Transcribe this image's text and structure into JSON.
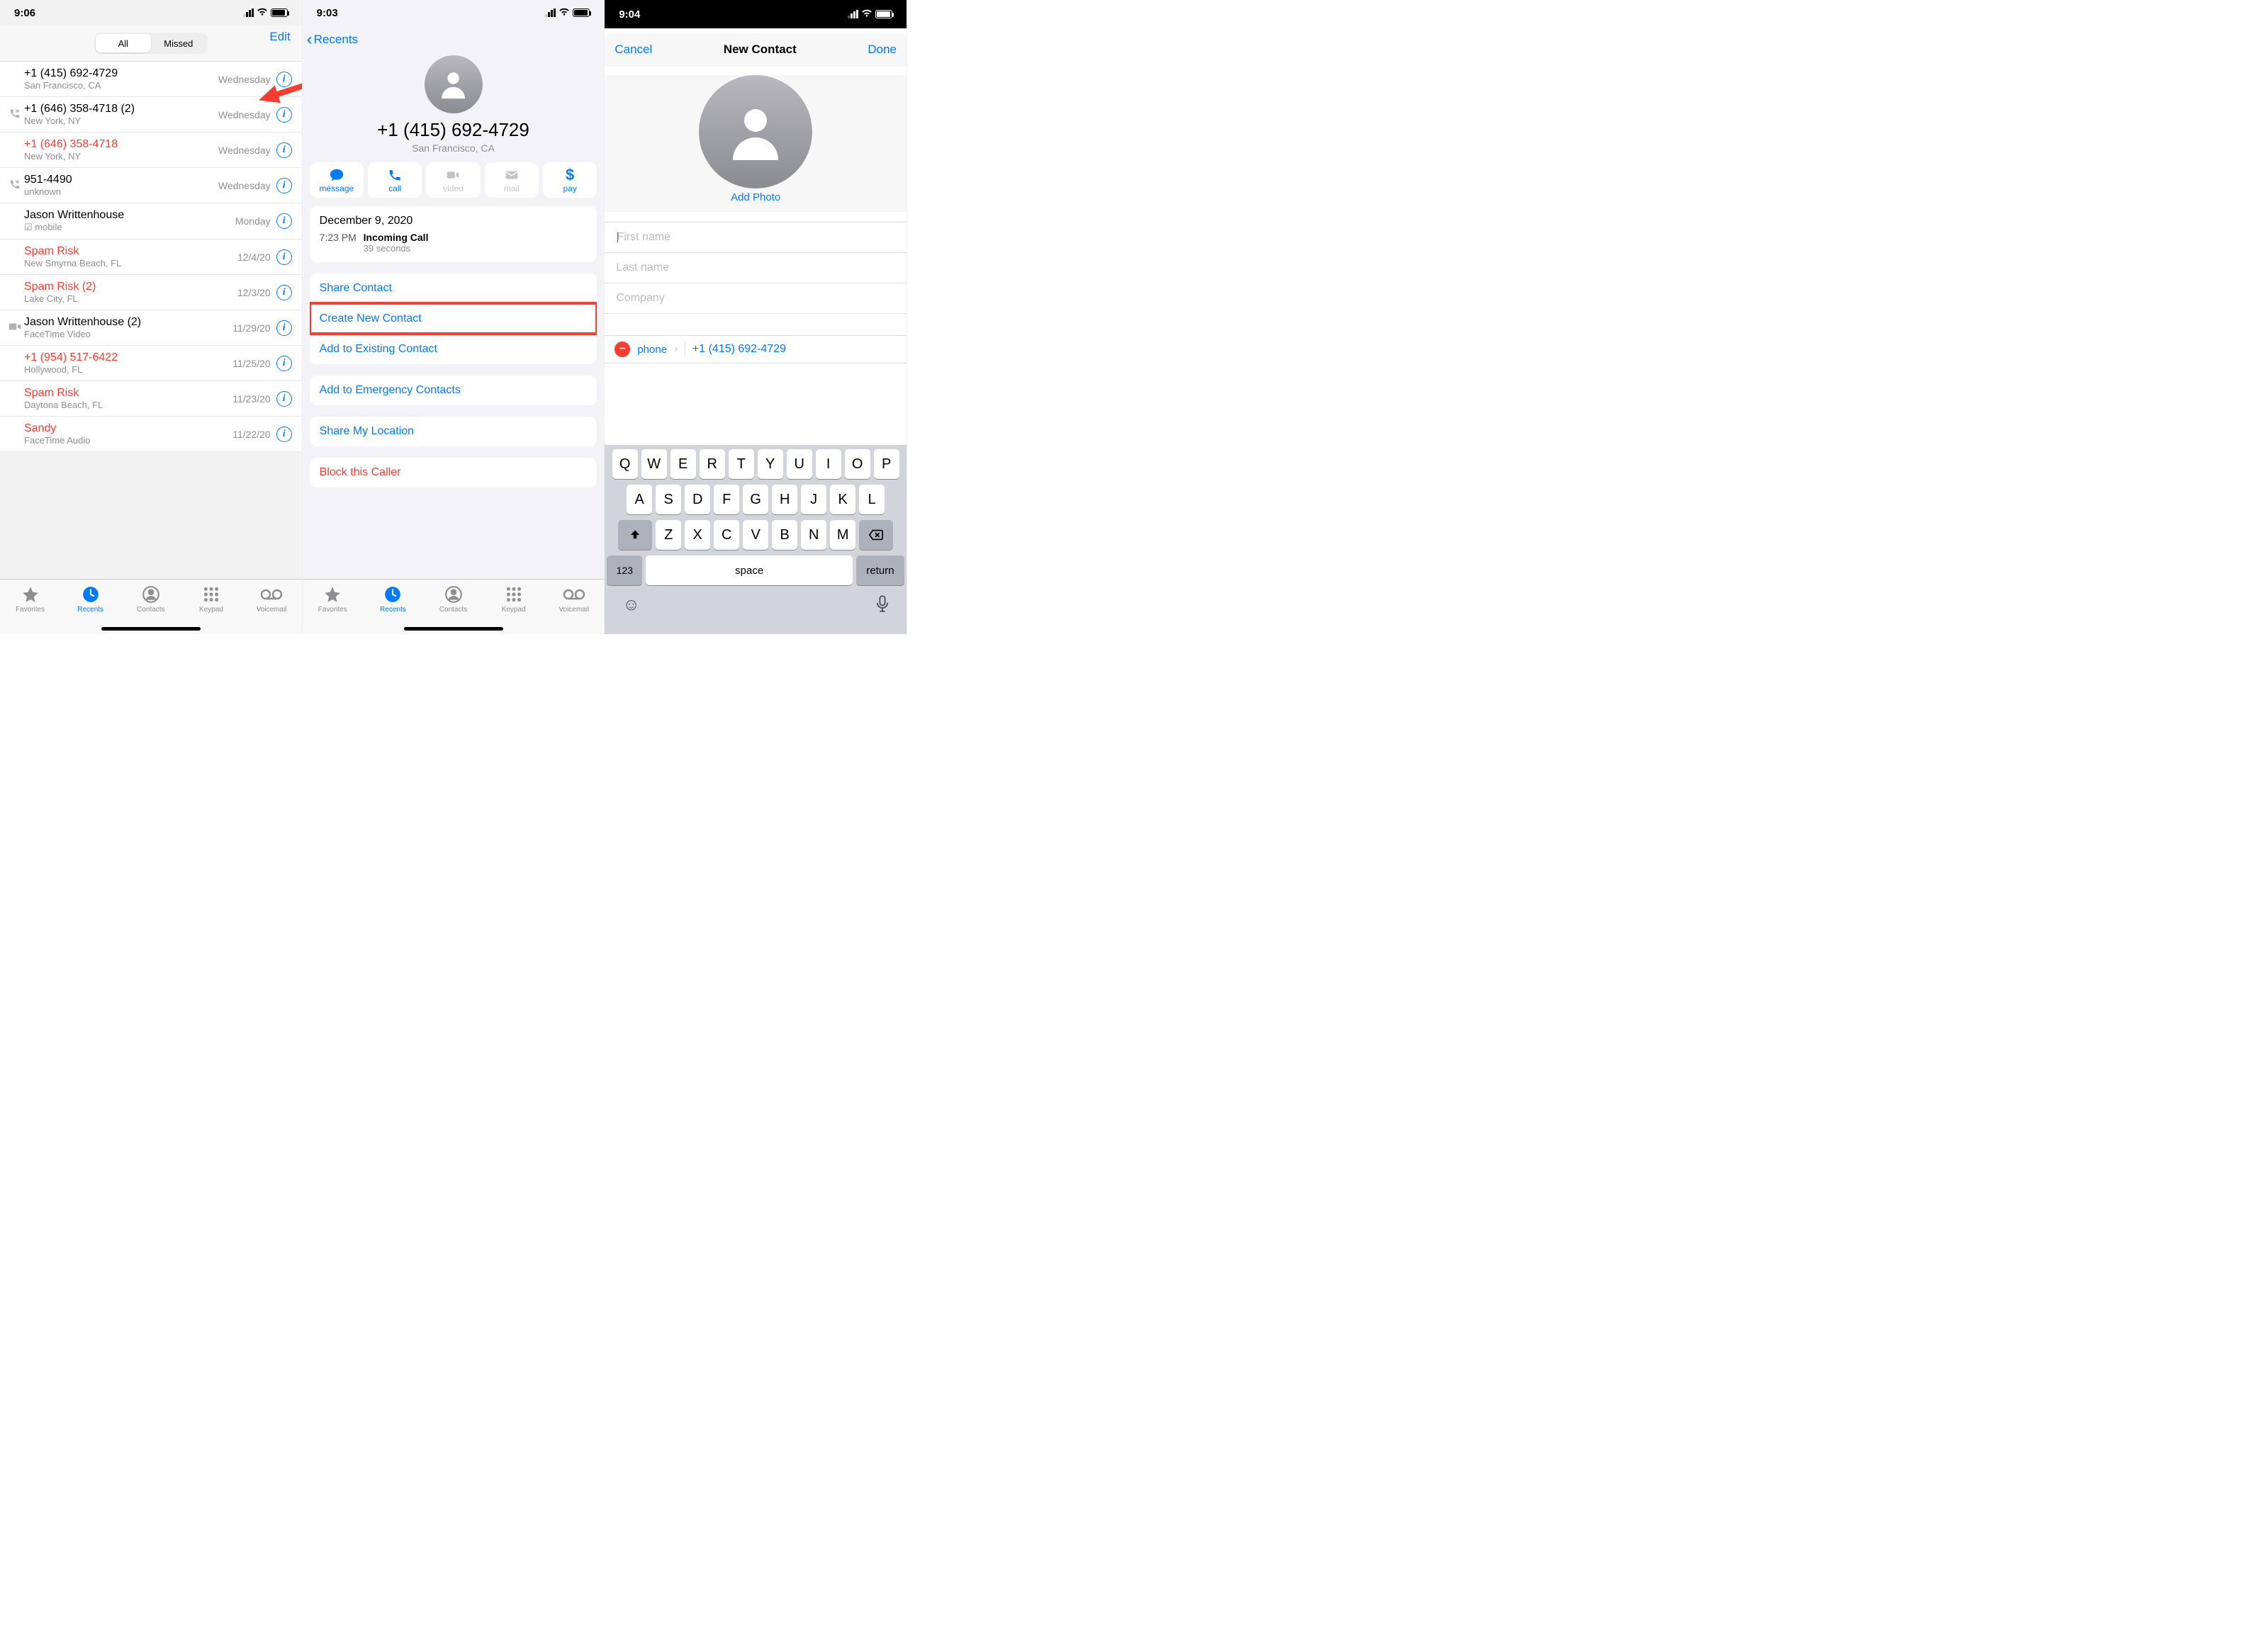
{
  "panel1": {
    "time": "9:06",
    "seg_all": "All",
    "seg_missed": "Missed",
    "edit": "Edit",
    "calls": [
      {
        "icon": "",
        "title": "+1 (415) 692-4729",
        "sub": "San Francisco, CA",
        "date": "Wednesday",
        "red": false
      },
      {
        "icon": "out",
        "title": "+1 (646) 358-4718 (2)",
        "sub": "New York, NY",
        "date": "Wednesday",
        "red": false
      },
      {
        "icon": "",
        "title": "+1 (646) 358-4718",
        "sub": "New York, NY",
        "date": "Wednesday",
        "red": true
      },
      {
        "icon": "out",
        "title": "951-4490",
        "sub": "unknown",
        "date": "Wednesday",
        "red": false
      },
      {
        "icon": "",
        "title": "Jason Writtenhouse",
        "sub": "☑ mobile",
        "date": "Monday",
        "red": false
      },
      {
        "icon": "",
        "title": "Spam Risk",
        "sub": "New Smyrna Beach, FL",
        "date": "12/4/20",
        "red": true
      },
      {
        "icon": "",
        "title": "Spam Risk (2)",
        "sub": "Lake City, FL",
        "date": "12/3/20",
        "red": true
      },
      {
        "icon": "video",
        "title": "Jason Writtenhouse (2)",
        "sub": "FaceTime Video",
        "date": "11/29/20",
        "red": false
      },
      {
        "icon": "",
        "title": "+1 (954) 517-6422",
        "sub": "Hollywood, FL",
        "date": "11/25/20",
        "red": true
      },
      {
        "icon": "",
        "title": "Spam Risk",
        "sub": "Daytona Beach, FL",
        "date": "11/23/20",
        "red": true
      },
      {
        "icon": "",
        "title": "Sandy",
        "sub": "FaceTime Audio",
        "date": "11/22/20",
        "red": true
      }
    ],
    "tabs": {
      "fav": "Favorites",
      "rec": "Recents",
      "con": "Contacts",
      "key": "Keypad",
      "vm": "Voicemail"
    }
  },
  "panel2": {
    "time": "9:03",
    "back": "Recents",
    "number": "+1 (415) 692-4729",
    "location": "San Francisco, CA",
    "actions": {
      "message": "message",
      "call": "call",
      "video": "video",
      "mail": "mail",
      "pay": "pay"
    },
    "history": {
      "date": "December 9, 2020",
      "time": "7:23 PM",
      "label": "Incoming Call",
      "dur": "39 seconds"
    },
    "menu": {
      "share": "Share Contact",
      "create": "Create New Contact",
      "add": "Add to Existing Contact",
      "emerg": "Add to Emergency Contacts",
      "loc": "Share My Location",
      "block": "Block this Caller"
    },
    "tabs": {
      "fav": "Favorites",
      "rec": "Recents",
      "con": "Contacts",
      "key": "Keypad",
      "vm": "Voicemail"
    }
  },
  "panel3": {
    "time": "9:04",
    "cancel": "Cancel",
    "title": "New Contact",
    "done": "Done",
    "addphoto": "Add Photo",
    "fields": {
      "first": "First name",
      "last": "Last name",
      "company": "Company"
    },
    "phone_label": "phone",
    "phone_value": "+1 (415) 692-4729",
    "kb": {
      "r1": [
        "Q",
        "W",
        "E",
        "R",
        "T",
        "Y",
        "U",
        "I",
        "O",
        "P"
      ],
      "r2": [
        "A",
        "S",
        "D",
        "F",
        "G",
        "H",
        "J",
        "K",
        "L"
      ],
      "r3": [
        "Z",
        "X",
        "C",
        "V",
        "B",
        "N",
        "M"
      ],
      "num": "123",
      "space": "space",
      "ret": "return"
    }
  }
}
